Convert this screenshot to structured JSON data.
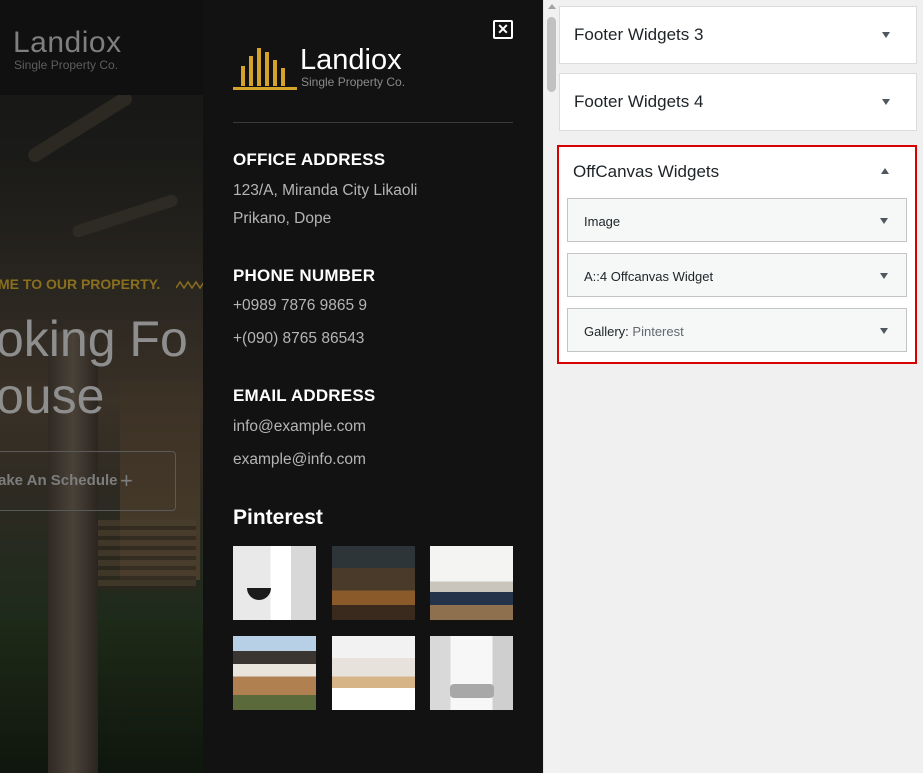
{
  "hero": {
    "logo_name": "Landiox",
    "logo_tagline": "Single Property Co.",
    "welcome": "ME TO OUR PROPERTY.",
    "headline_line1": "oking Fo",
    "headline_line2": "ouse",
    "schedule_label": "ake An Schedule",
    "schedule_icon": "+"
  },
  "offcanvas": {
    "close_icon": "✕",
    "logo_name": "Landiox",
    "logo_tagline": "Single Property Co.",
    "office": {
      "heading": "OFFICE ADDRESS",
      "line1": "123/A, Miranda City Likaoli",
      "line2": "Prikano, Dope"
    },
    "phone": {
      "heading": "PHONE NUMBER",
      "line1": "+0989 7876 9865 9",
      "line2": "+(090) 8765 86543"
    },
    "email": {
      "heading": "EMAIL ADDRESS",
      "line1": "info@example.com",
      "line2": "example@info.com"
    },
    "pinterest_heading": "Pinterest",
    "gallery_icons": [
      "bathroom-photo",
      "dining-room-photo",
      "dining-area-photo",
      "house-exterior-photo",
      "kitchen-photo",
      "living-room-photo"
    ]
  },
  "customizer": {
    "sections": [
      {
        "title": "Footer Widgets 3"
      },
      {
        "title": "Footer Widgets 4"
      }
    ],
    "offcanvas_section": {
      "title": "OffCanvas Widgets",
      "widgets": [
        {
          "title": "Image",
          "subtitle": ""
        },
        {
          "title": "A::4 Offcanvas Widget",
          "subtitle": ""
        },
        {
          "title": "Gallery:",
          "subtitle": "Pinterest"
        }
      ]
    }
  },
  "colors": {
    "accent_gold": "#d4a32a",
    "highlight_red": "#d80000",
    "offcanvas_bg": "#121212"
  }
}
